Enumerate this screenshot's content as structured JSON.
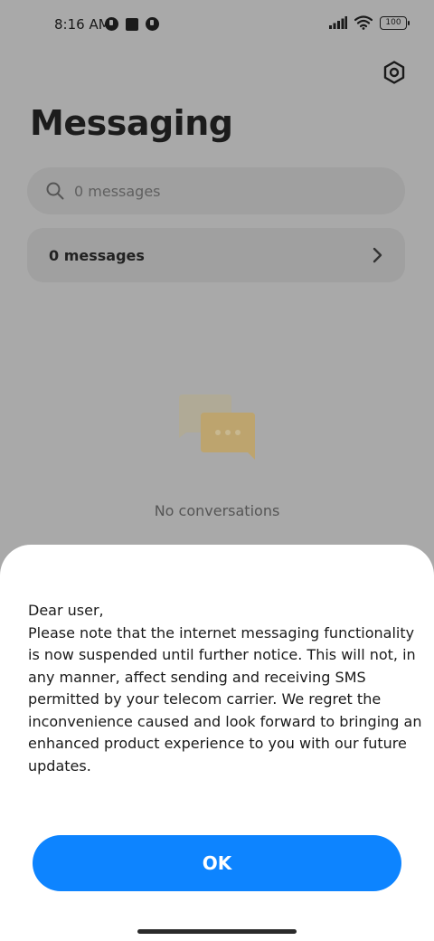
{
  "status_bar": {
    "time": "8:16 AM",
    "battery": "100"
  },
  "header": {
    "title": "Messaging",
    "settings_icon": "gear-hexagon-icon"
  },
  "search": {
    "placeholder": "0 messages"
  },
  "messages_row": {
    "label": "0 messages"
  },
  "empty_state": {
    "text": "No conversations"
  },
  "dialog": {
    "body": "Dear user,\nPlease note that the internet messaging functionality is now suspended until further notice. This will not, in any manner, affect sending and receiving SMS permitted by your telecom carrier. We regret the inconvenience caused and look forward to bringing an enhanced product experience to you with our future updates.",
    "ok_label": "OK"
  },
  "colors": {
    "accent": "#0d84ff",
    "dim_background": "#a9a9a9",
    "sheet": "#ffffff"
  }
}
